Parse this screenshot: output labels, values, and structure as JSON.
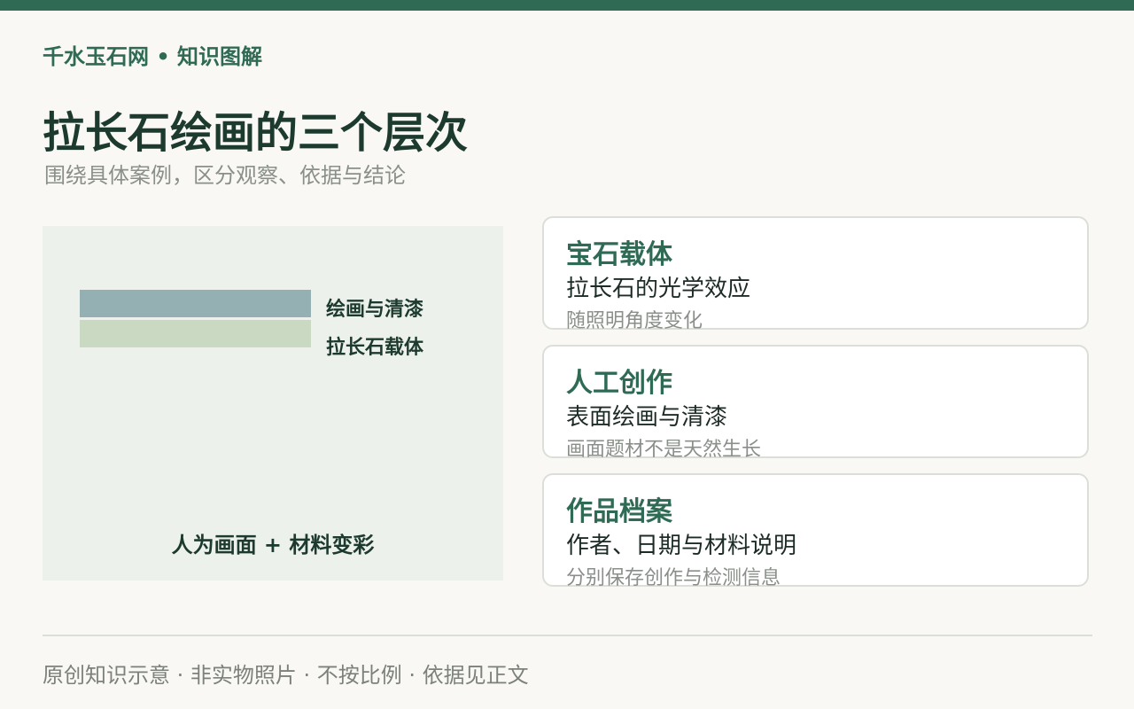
{
  "colors": {
    "accent": "#2f6a54",
    "title": "#1d3a2e",
    "muted": "#8a8f8a",
    "panel_bg": "#edf1ec",
    "layer_paint": "#95b0b3",
    "layer_stone": "#cad9c2",
    "card_border": "#dcdfd8"
  },
  "header": {
    "brand": "千水玉石网 • 知识图解",
    "title": "拉长石绘画的三个层次",
    "subtitle": "围绕具体案例，区分观察、依据与结论"
  },
  "diagram": {
    "layers": [
      {
        "label": "绘画与清漆"
      },
      {
        "label": "拉长石载体"
      }
    ],
    "caption": "人为画面 + 材料变彩"
  },
  "cards": [
    {
      "title": "宝石载体",
      "main": "拉长石的光学效应",
      "note": "随照明角度变化"
    },
    {
      "title": "人工创作",
      "main": "表面绘画与清漆",
      "note": "画面题材不是天然生长"
    },
    {
      "title": "作品档案",
      "main": "作者、日期与材料说明",
      "note": "分别保存创作与检测信息"
    }
  ],
  "footer": "原创知识示意 · 非实物照片 · 不按比例 · 依据见正文"
}
